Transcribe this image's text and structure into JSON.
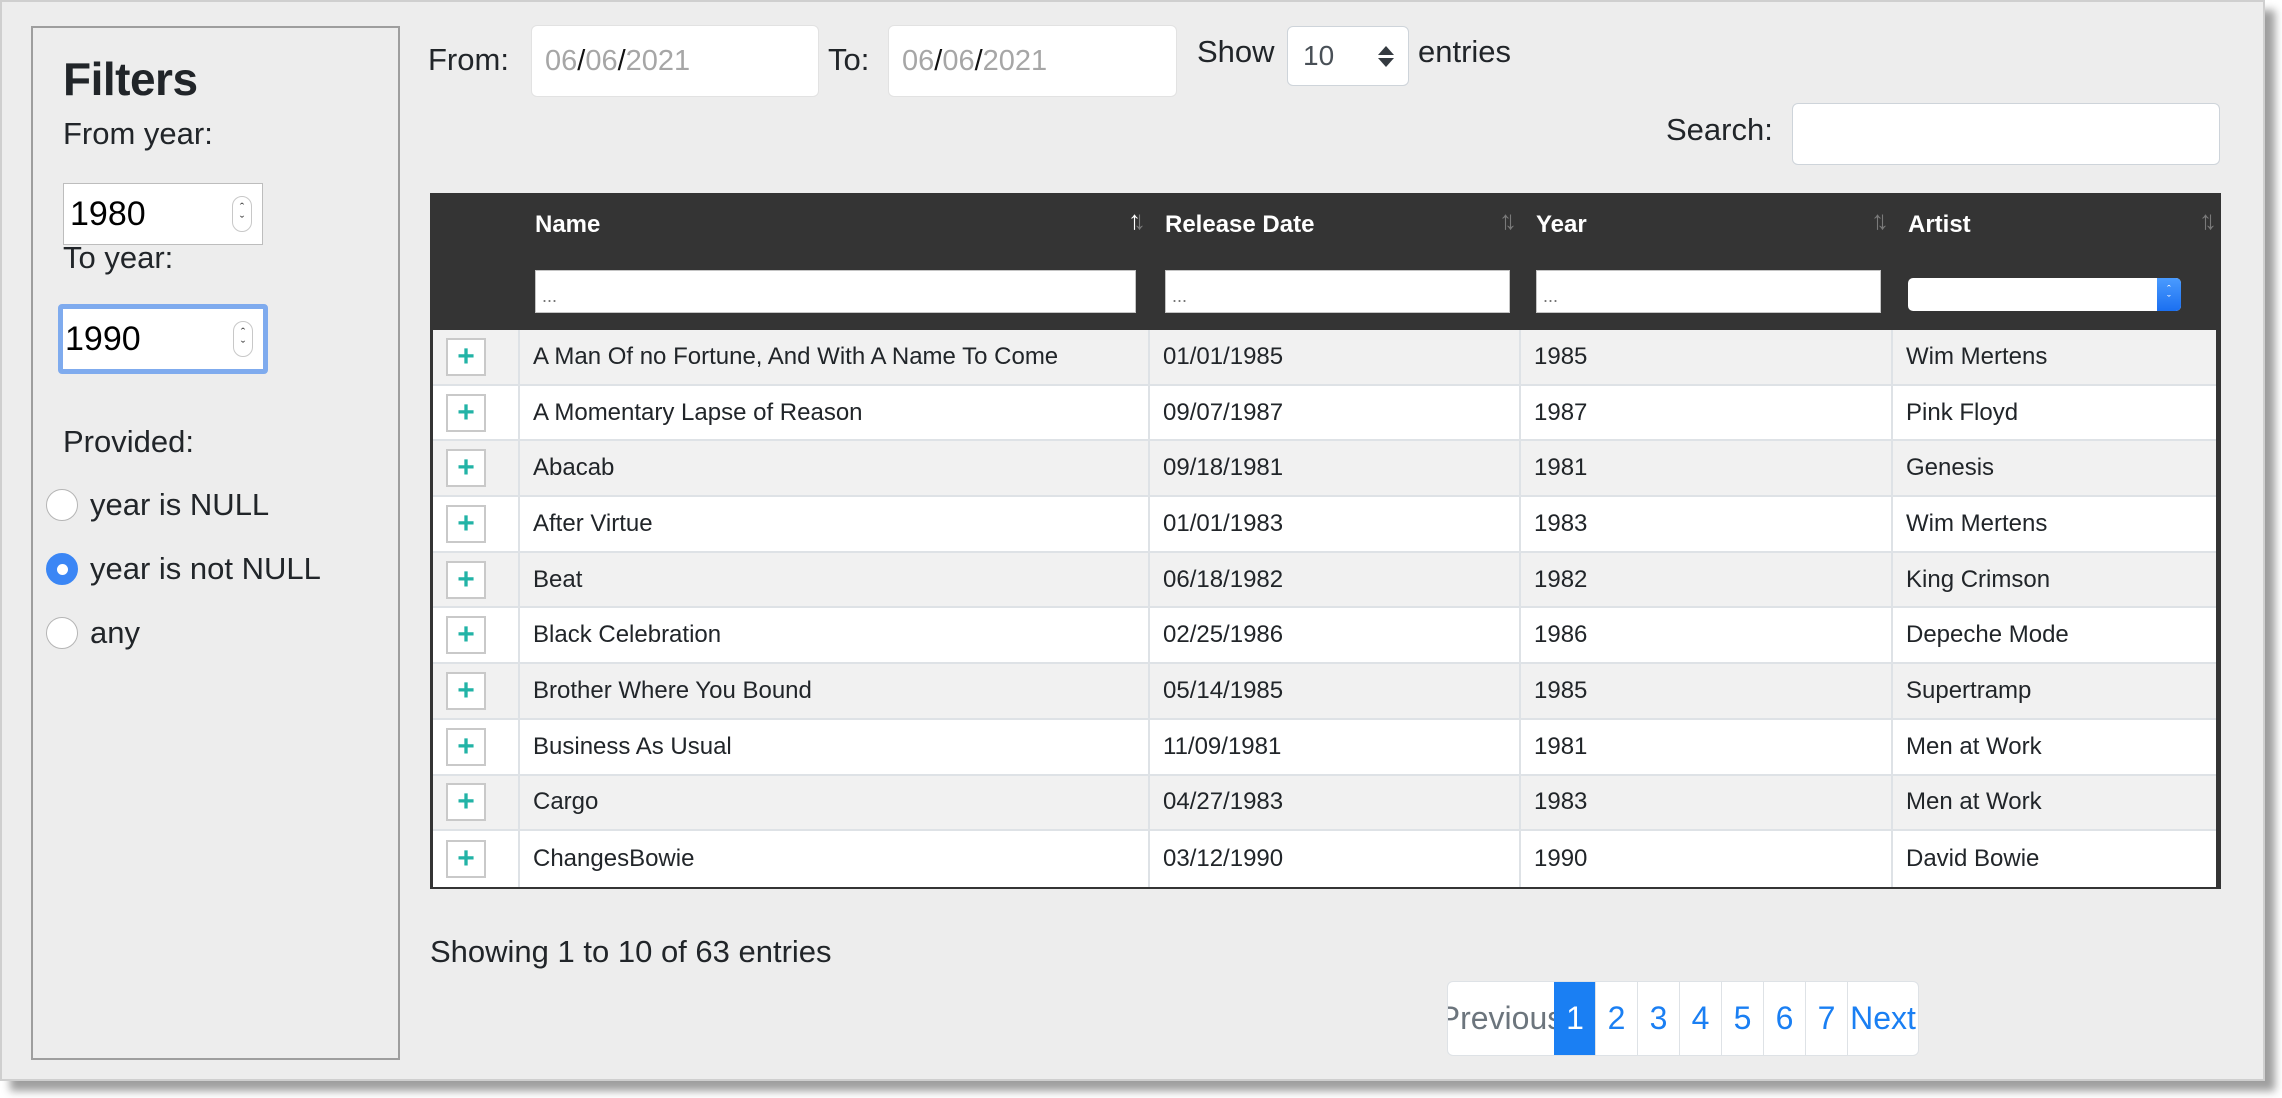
{
  "filters": {
    "title": "Filters",
    "from_year_label": "From year:",
    "from_year_value": "1980",
    "to_year_label": "To year:",
    "to_year_value": "1990",
    "provided_label": "Provided:",
    "radio_options": [
      {
        "label": "year is NULL",
        "checked": false
      },
      {
        "label": "year is not NULL",
        "checked": true
      },
      {
        "label": "any",
        "checked": false
      }
    ]
  },
  "toolbar": {
    "from_label": "From:",
    "from_date": {
      "month": "06",
      "day": "06",
      "year": "2021"
    },
    "to_label": "To:",
    "to_date": {
      "month": "06",
      "day": "06",
      "year": "2021"
    },
    "show_label": "Show",
    "entries_value": "10",
    "entries_label": "entries",
    "search_label": "Search:",
    "search_value": ""
  },
  "table": {
    "columns": [
      {
        "label": "Name",
        "sort": "asc",
        "filter_placeholder": "..."
      },
      {
        "label": "Release Date",
        "sort": "none",
        "filter_placeholder": "..."
      },
      {
        "label": "Year",
        "sort": "none",
        "filter_placeholder": "..."
      },
      {
        "label": "Artist",
        "sort": "none",
        "filter_type": "select",
        "filter_value": ""
      }
    ],
    "rows": [
      {
        "name": "A Man Of no Fortune, And With A Name To Come",
        "release_date": "01/01/1985",
        "year": "1985",
        "artist": "Wim Mertens"
      },
      {
        "name": "A Momentary Lapse of Reason",
        "release_date": "09/07/1987",
        "year": "1987",
        "artist": "Pink Floyd"
      },
      {
        "name": "Abacab",
        "release_date": "09/18/1981",
        "year": "1981",
        "artist": "Genesis"
      },
      {
        "name": "After Virtue",
        "release_date": "01/01/1983",
        "year": "1983",
        "artist": "Wim Mertens"
      },
      {
        "name": "Beat",
        "release_date": "06/18/1982",
        "year": "1982",
        "artist": "King Crimson"
      },
      {
        "name": "Black Celebration",
        "release_date": "02/25/1986",
        "year": "1986",
        "artist": "Depeche Mode"
      },
      {
        "name": "Brother Where You Bound",
        "release_date": "05/14/1985",
        "year": "1985",
        "artist": "Supertramp"
      },
      {
        "name": "Business As Usual",
        "release_date": "11/09/1981",
        "year": "1981",
        "artist": "Men at Work"
      },
      {
        "name": "Cargo",
        "release_date": "04/27/1983",
        "year": "1983",
        "artist": "Men at Work"
      },
      {
        "name": "ChangesBowie",
        "release_date": "03/12/1990",
        "year": "1990",
        "artist": "David Bowie"
      }
    ],
    "expand_icon": "plus-icon"
  },
  "footer": {
    "info": "Showing 1 to 10 of 63 entries",
    "pagination": {
      "previous": "Previous",
      "pages": [
        "1",
        "2",
        "3",
        "4",
        "5",
        "6",
        "7"
      ],
      "active": "1",
      "next": "Next"
    }
  },
  "colors": {
    "accent": "#1a7ff3",
    "header_bg": "#343434",
    "expand_icon": "#22b3a6",
    "focus_ring": "#7fabee",
    "radio_checked": "#3b86f5"
  }
}
